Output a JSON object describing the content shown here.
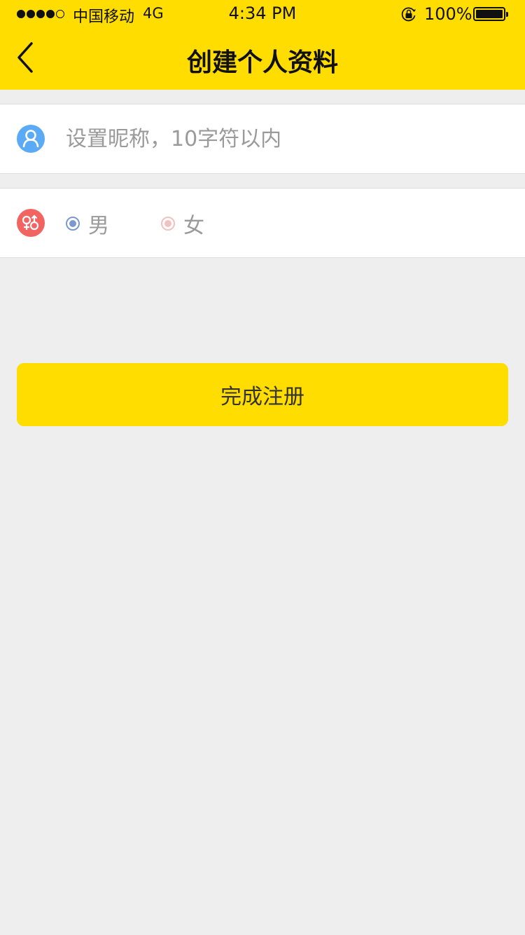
{
  "status_bar": {
    "carrier": "中国移动",
    "network": "4G",
    "time": "4:34 PM",
    "battery_percent": "100%",
    "signal_bars_filled": 4,
    "signal_bars_total": 5
  },
  "nav": {
    "title": "创建个人资料",
    "back_icon": "chevron-left-icon"
  },
  "profile_form": {
    "nickname": {
      "icon": "person-icon",
      "value": "",
      "placeholder": "设置昵称，10字符以内"
    },
    "gender": {
      "icon": "gender-icon",
      "options": [
        {
          "label": "男",
          "selected": true
        },
        {
          "label": "女",
          "selected": false
        }
      ]
    },
    "submit_label": "完成注册"
  },
  "colors": {
    "accent": "#ffdd00",
    "background": "#eeeeee",
    "nickname_icon_bg": "#5aaaf5",
    "gender_icon_bg": "#f26462",
    "male_radio": "#7b9acb",
    "female_radio": "#f0c2c0"
  }
}
